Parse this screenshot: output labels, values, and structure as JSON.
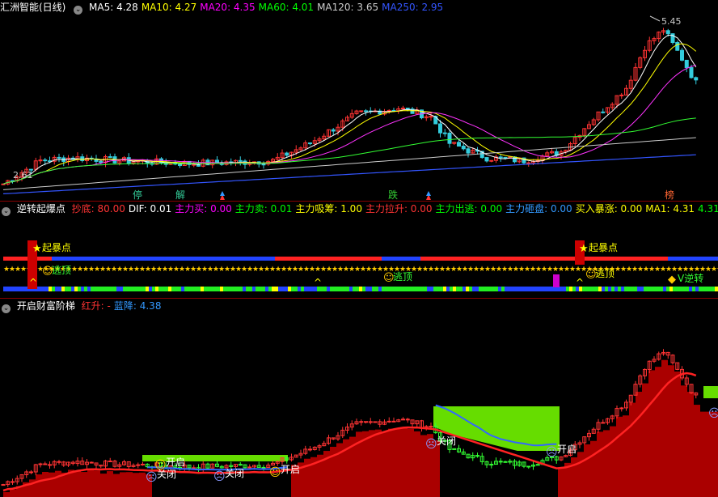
{
  "pane1": {
    "title": "汇洲智能(日线)",
    "indicators": [
      {
        "label": "MA5:",
        "value": "4.28",
        "color": "#ffffff"
      },
      {
        "label": "MA10:",
        "value": "4.27",
        "color": "#ffff00"
      },
      {
        "label": "MA20:",
        "value": "4.35",
        "color": "#ff00ff"
      },
      {
        "label": "MA60:",
        "value": "4.01",
        "color": "#00ff00"
      },
      {
        "label": "MA120:",
        "value": "3.65",
        "color": "#cccccc"
      },
      {
        "label": "MA250:",
        "value": "2.95",
        "color": "#3355ff"
      }
    ],
    "high_label": "5.45",
    "low_label": "2.61",
    "markers": [
      "停",
      "解",
      "跌",
      "榜"
    ]
  },
  "pane2": {
    "title": "逆转起爆点",
    "indicators": [
      {
        "label": "抄底:",
        "value": "80.00",
        "color": "#ff3333"
      },
      {
        "label": "DIF:",
        "value": "0.01",
        "color": "#ffffff"
      },
      {
        "label": "主力买:",
        "value": "0.00",
        "color": "#ff00ff"
      },
      {
        "label": "主力卖:",
        "value": "0.01",
        "color": "#00ff00"
      },
      {
        "label": "主力吸筹:",
        "value": "1.00",
        "color": "#ffff00"
      },
      {
        "label": "主力拉升:",
        "value": "0.00",
        "color": "#ff3333"
      },
      {
        "label": "主力出逃:",
        "value": "0.00",
        "color": "#00ff00"
      },
      {
        "label": "主力砸盘:",
        "value": "0.00",
        "color": "#3399ff"
      },
      {
        "label": "买入暴涨:",
        "value": "0.00",
        "color": "#ffff00"
      },
      {
        "label": "MA1:",
        "value": "4.31",
        "color": "#ffff00"
      },
      {
        "label": "",
        "value": "4.31",
        "color": "#00ff00"
      },
      {
        "label": "控盘程",
        "value": "",
        "color": "#ffffff"
      }
    ],
    "signals": [
      "起暴点",
      "逃顶",
      "起暴点",
      "逃顶",
      "逃顶",
      "V逆转"
    ]
  },
  "pane3": {
    "title": "开启财富阶梯",
    "indicators": [
      {
        "label": "红升:",
        "value": "-",
        "color": "#ff3333"
      },
      {
        "label": "蓝降:",
        "value": "4.38",
        "color": "#3399ff"
      }
    ],
    "labels": [
      "开启",
      "关闭",
      "关闭",
      "开启",
      "关闭",
      "开启"
    ]
  }
}
